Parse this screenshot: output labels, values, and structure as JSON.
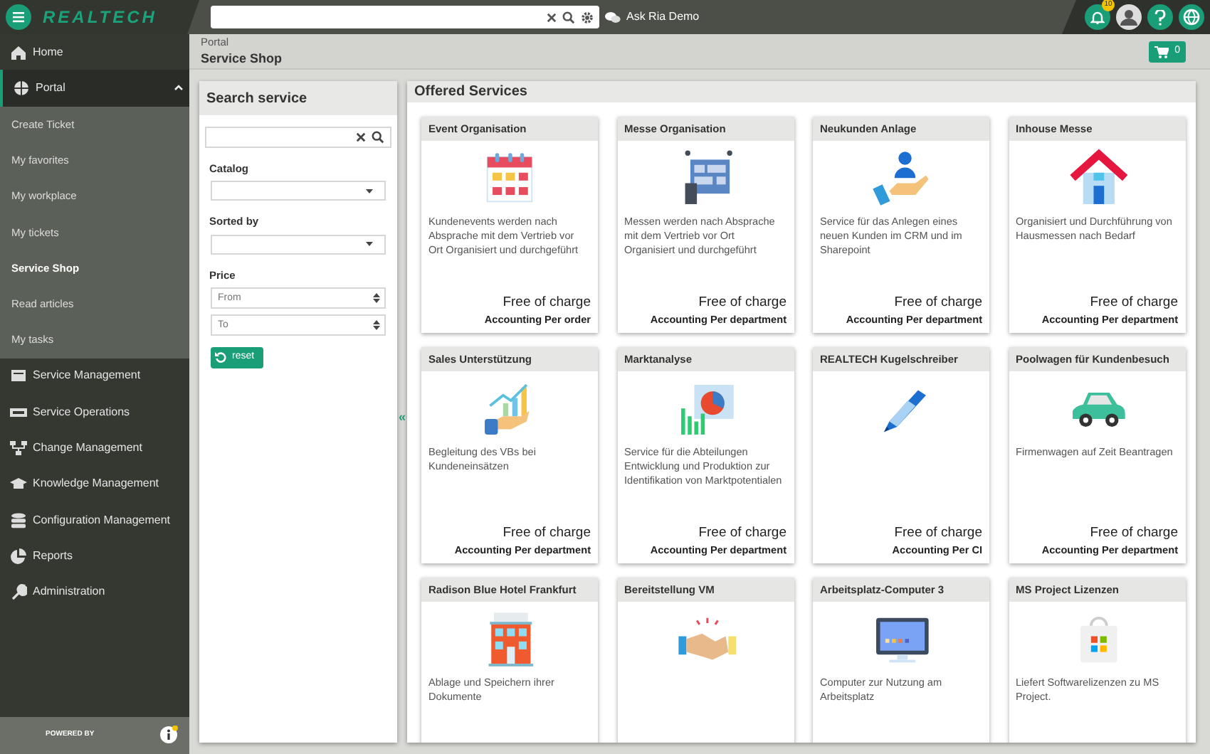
{
  "topbar": {
    "logo": "REALTECH",
    "ask_link": "Ask Ria Demo",
    "notification_count": "10"
  },
  "sidebar": {
    "items": [
      {
        "label": "Home",
        "selected": false
      },
      {
        "label": "Portal",
        "selected": true,
        "expanded": true,
        "children": [
          {
            "label": "Create Ticket",
            "selected": false
          },
          {
            "label": "My favorites",
            "selected": false
          },
          {
            "label": "My workplace",
            "selected": false
          },
          {
            "label": "My tickets",
            "selected": false
          },
          {
            "label": "Service Shop",
            "selected": true
          },
          {
            "label": "Read articles",
            "selected": false
          },
          {
            "label": "My tasks",
            "selected": false
          }
        ]
      },
      {
        "label": "Service Management",
        "selected": false
      },
      {
        "label": "Service Operations",
        "selected": false
      },
      {
        "label": "Change Management",
        "selected": false
      },
      {
        "label": "Knowledge Management",
        "selected": false
      },
      {
        "label": "Configuration Management",
        "selected": false
      },
      {
        "label": "Reports",
        "selected": false
      },
      {
        "label": "Administration",
        "selected": false
      }
    ],
    "footer": {
      "powered_by": "POWERED BY"
    }
  },
  "breadcrumb": {
    "parent": "Portal",
    "title": "Service Shop"
  },
  "cart": {
    "count": "0"
  },
  "search_panel": {
    "title": "Search service",
    "catalog_label": "Catalog",
    "sorted_label": "Sorted by",
    "price_label": "Price",
    "from_placeholder": "From",
    "to_placeholder": "To",
    "reset": "reset"
  },
  "collapse_glyph": "«",
  "services": {
    "title": "Offered Services",
    "cards": [
      {
        "title": "Event Organisation",
        "description": "Kundenevents werden nach Absprache mit dem Vertrieb vor Ort Organisiert und durchgeführt",
        "price": "Free of charge",
        "accounting": "Accounting Per order"
      },
      {
        "title": "Messe Organisation",
        "description": "Messen werden nach Absprache mit dem Vertrieb vor Ort Organisiert und durchgeführt",
        "price": "Free of charge",
        "accounting": "Accounting Per department"
      },
      {
        "title": "Neukunden Anlage",
        "description": "Service für das Anlegen eines neuen Kunden im CRM und im Sharepoint",
        "price": "Free of charge",
        "accounting": "Accounting Per department"
      },
      {
        "title": "Inhouse Messe",
        "description": "Organisiert und Durchführung von Hausmessen nach Bedarf",
        "price": "Free of charge",
        "accounting": "Accounting Per department"
      },
      {
        "title": "Sales Unterstützung",
        "description": "Begleitung des VBs bei Kundeneinsätzen",
        "price": "Free of charge",
        "accounting": "Accounting Per department"
      },
      {
        "title": "Marktanalyse",
        "description": "Service für die Abteilungen Entwicklung und Produktion zur Identifikation von Marktpotentialen",
        "price": "Free of charge",
        "accounting": "Accounting Per department"
      },
      {
        "title": "REALTECH Kugelschreiber",
        "price": "Free of charge",
        "accounting": "Accounting Per CI"
      },
      {
        "title": "Poolwagen für Kundenbesuch",
        "description": "Firmenwagen auf Zeit Beantragen",
        "price": "Free of charge",
        "accounting": "Accounting Per department"
      },
      {
        "title": "Radison Blue Hotel Frankfurt",
        "description": "Ablage und Speichern ihrer Dokumente"
      },
      {
        "title": "Bereitstellung VM"
      },
      {
        "title": "Arbeitsplatz-Computer 3",
        "description": "Computer zur Nutzung am Arbeitsplatz"
      },
      {
        "title": "MS Project Lizenzen",
        "description": "Liefert Softwarelizenzen zu MS Project."
      }
    ]
  }
}
